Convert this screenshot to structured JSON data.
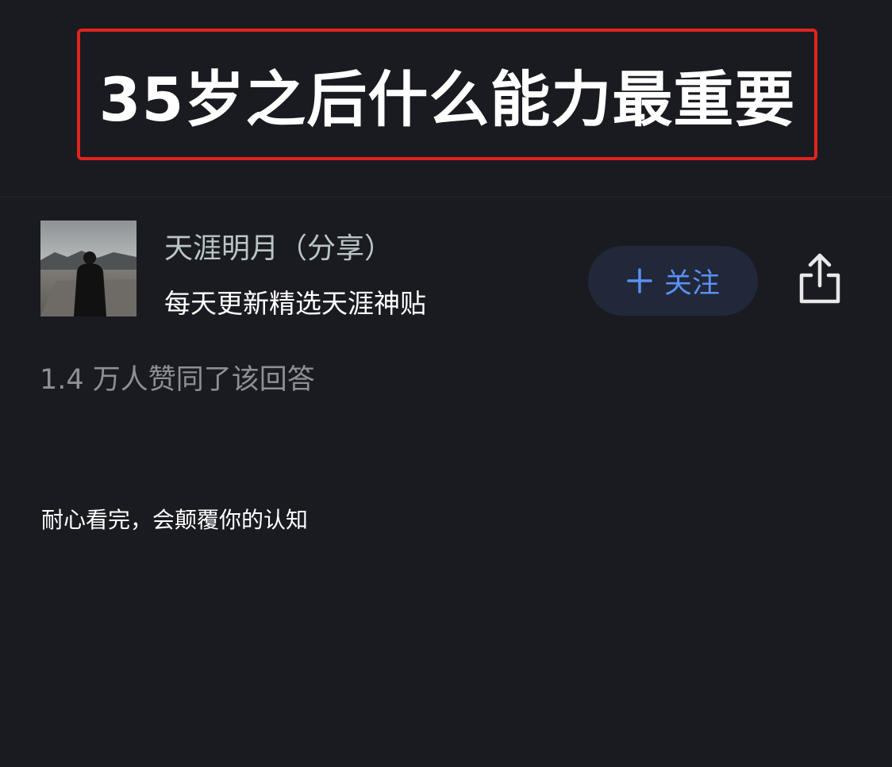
{
  "question": {
    "title": "35岁之后什么能力最重要"
  },
  "author": {
    "name": "天涯明月（分享）",
    "bio": "每天更新精选天涯神贴",
    "avatar_icon": "person-photo-avatar"
  },
  "actions": {
    "follow_label": "关注",
    "follow_icon": "plus-icon",
    "share_icon": "share-icon"
  },
  "stats": {
    "likes_text": "1.4 万人赞同了该回答"
  },
  "answer": {
    "first_line": "耐心看完，会颠覆你的认知"
  },
  "colors": {
    "background": "#1a1b20",
    "highlight_border": "#e0241f",
    "follow_text": "#5b8ff2",
    "follow_bg": "#20283a"
  }
}
